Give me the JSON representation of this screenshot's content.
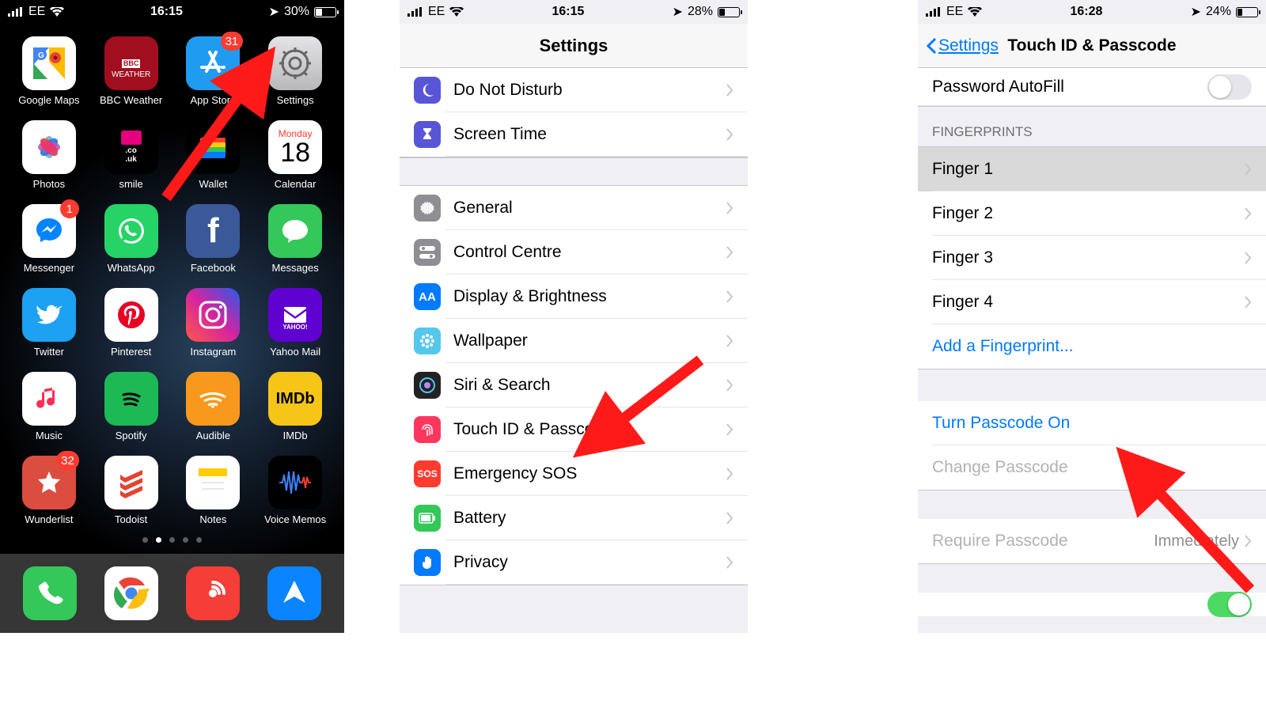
{
  "screens": {
    "home": {
      "status": {
        "carrier": "EE",
        "time": "16:15",
        "battery_pct": "30%",
        "location": true
      },
      "apps": [
        {
          "name": "Google Maps",
          "bg": "#fff"
        },
        {
          "name": "BBC Weather",
          "bg": "#a10e1f"
        },
        {
          "name": "App Store",
          "bg": "#1f9cf0",
          "badge": "31"
        },
        {
          "name": "Settings",
          "bg": "linear-gradient(#e4e4e6,#b8b8bc)"
        },
        {
          "name": "Photos",
          "bg": "#fff"
        },
        {
          "name": "smile",
          "bg": "#000"
        },
        {
          "name": "Wallet",
          "bg": "#000"
        },
        {
          "name": "Calendar",
          "bg": "#fff"
        },
        {
          "name": "Messenger",
          "bg": "#fff",
          "badge": "1"
        },
        {
          "name": "WhatsApp",
          "bg": "#25d366"
        },
        {
          "name": "Facebook",
          "bg": "#3b5998"
        },
        {
          "name": "Messages",
          "bg": "#34c759"
        },
        {
          "name": "Twitter",
          "bg": "#1da1f2"
        },
        {
          "name": "Pinterest",
          "bg": "#fff"
        },
        {
          "name": "Instagram",
          "bg": "linear-gradient(45deg,#fd5949,#d6249f,#285AEB)"
        },
        {
          "name": "Yahoo Mail",
          "bg": "#5f01d1"
        },
        {
          "name": "Music",
          "bg": "#fff"
        },
        {
          "name": "Spotify",
          "bg": "#1db954"
        },
        {
          "name": "Audible",
          "bg": "#f8991d"
        },
        {
          "name": "IMDb",
          "bg": "#f5c518"
        },
        {
          "name": "Wunderlist",
          "bg": "#db4d3f",
          "badge": "32"
        },
        {
          "name": "Todoist",
          "bg": "#fff"
        },
        {
          "name": "Notes",
          "bg": "#fff"
        },
        {
          "name": "Voice Memos",
          "bg": "#000"
        }
      ],
      "calendar": {
        "dow": "Monday",
        "dom": "18"
      },
      "dock": [
        {
          "name": "Phone",
          "bg": "#34c759"
        },
        {
          "name": "Chrome",
          "bg": "#fff"
        },
        {
          "name": "Pocket Casts",
          "bg": "#f43e37"
        },
        {
          "name": "Arrow",
          "bg": "#0a84ff"
        }
      ]
    },
    "settings": {
      "status": {
        "carrier": "EE",
        "time": "16:15",
        "battery_pct": "28%"
      },
      "title": "Settings",
      "rows_top": [
        {
          "label": "Do Not Disturb",
          "bg": "#5856d6",
          "icon": "moon"
        },
        {
          "label": "Screen Time",
          "bg": "#5856d6",
          "icon": "hourglass"
        }
      ],
      "rows_mid": [
        {
          "label": "General",
          "bg": "#8e8e93",
          "icon": "gear"
        },
        {
          "label": "Control Centre",
          "bg": "#8e8e93",
          "icon": "toggles"
        },
        {
          "label": "Display & Brightness",
          "bg": "#007aff",
          "icon": "AA"
        },
        {
          "label": "Wallpaper",
          "bg": "#54c7ec",
          "icon": "flower"
        },
        {
          "label": "Siri & Search",
          "bg": "#222",
          "icon": "siri"
        },
        {
          "label": "Touch ID & Passcode",
          "bg": "#ff375f",
          "icon": "fingerprint"
        },
        {
          "label": "Emergency SOS",
          "bg": "#ff3b30",
          "icon": "SOS"
        },
        {
          "label": "Battery",
          "bg": "#34c759",
          "icon": "battery"
        },
        {
          "label": "Privacy",
          "bg": "#007aff",
          "icon": "hand"
        }
      ]
    },
    "touchid": {
      "status": {
        "carrier": "EE",
        "time": "16:28",
        "battery_pct": "24%"
      },
      "back": "Settings",
      "title": "Touch ID & Passcode",
      "autofill": "Password AutoFill",
      "fingerprints_header": "FINGERPRINTS",
      "fingers": [
        "Finger 1",
        "Finger 2",
        "Finger 3",
        "Finger 4"
      ],
      "add_finger": "Add a Fingerprint...",
      "turn_on": "Turn Passcode On",
      "change": "Change Passcode",
      "require_label": "Require Passcode",
      "require_value": "Immediately"
    }
  }
}
